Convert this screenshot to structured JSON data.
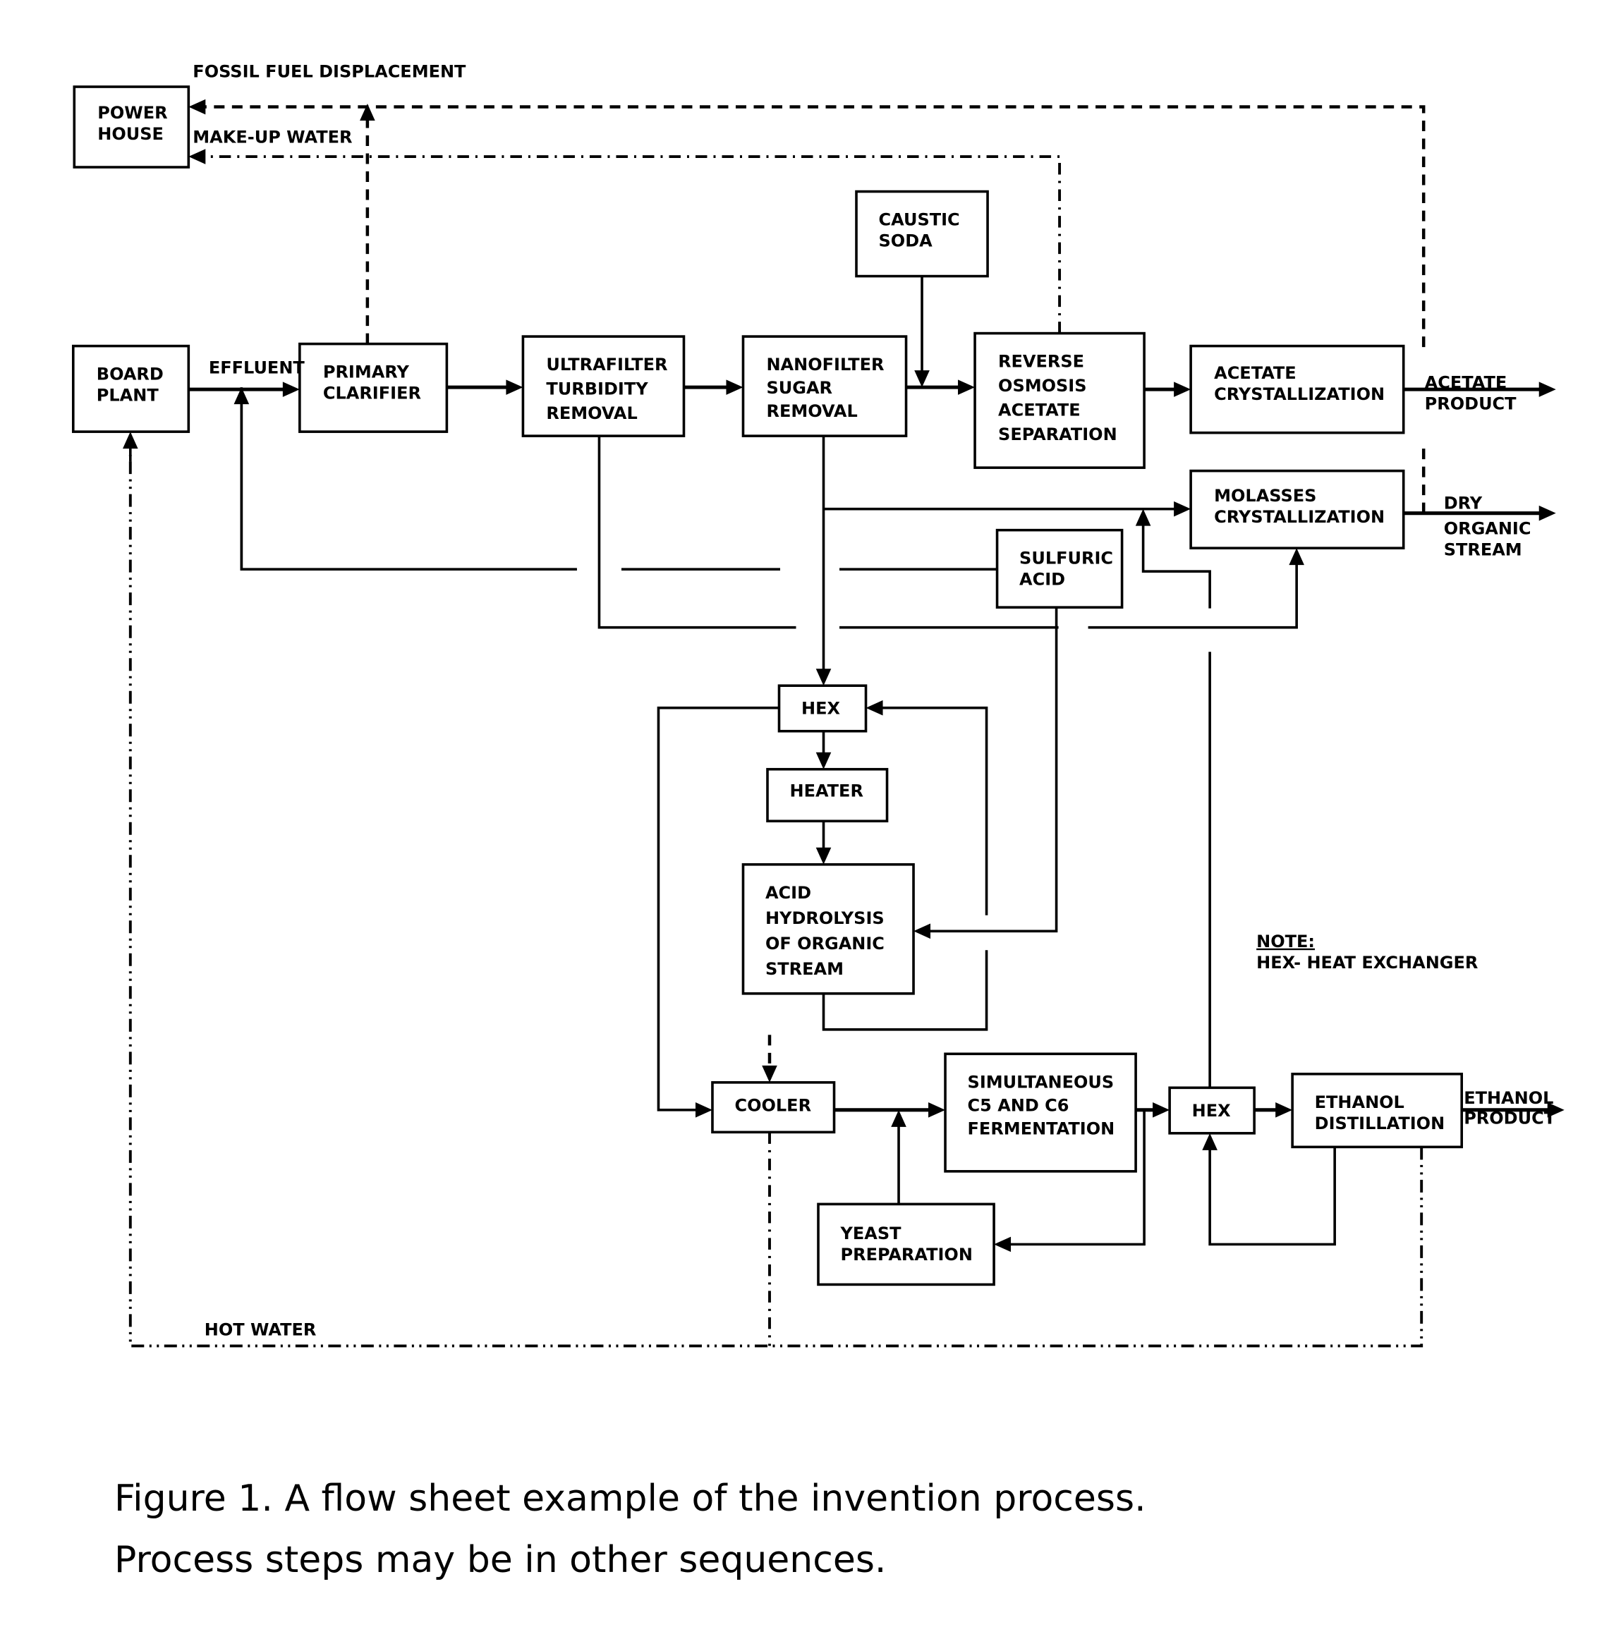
{
  "units": {
    "power_house": [
      "POWER",
      "HOUSE"
    ],
    "board_plant": [
      "BOARD",
      "PLANT"
    ],
    "primary_clarifier": [
      "PRIMARY",
      "CLARIFIER"
    ],
    "ultrafilter": [
      "ULTRAFILTER",
      "TURBIDITY",
      "REMOVAL"
    ],
    "nanofilter": [
      "NANOFILTER",
      "SUGAR",
      "REMOVAL"
    ],
    "caustic_soda": [
      "CAUSTIC",
      "SODA"
    ],
    "reverse_osmosis": [
      "REVERSE",
      "OSMOSIS",
      "ACETATE",
      "SEPARATION"
    ],
    "acetate_crystallization": [
      "ACETATE",
      "CRYSTALLIZATION"
    ],
    "molasses_crystallization": [
      "MOLASSES",
      "CRYSTALLIZATION"
    ],
    "sulfuric_acid": [
      "SULFURIC",
      "ACID"
    ],
    "hex_top": [
      "HEX"
    ],
    "heater": [
      "HEATER"
    ],
    "acid_hydrolysis": [
      "ACID",
      "HYDROLYSIS",
      "OF ORGANIC",
      "STREAM"
    ],
    "cooler": [
      "COOLER"
    ],
    "fermentation": [
      "SIMULTANEOUS",
      "C5 AND C6",
      "FERMENTATION"
    ],
    "yeast_preparation": [
      "YEAST",
      "PREPARATION"
    ],
    "hex_bottom": [
      "HEX"
    ],
    "ethanol_distillation": [
      "ETHANOL",
      "DISTILLATION"
    ]
  },
  "stream_labels": {
    "fossil_fuel": "FOSSIL FUEL DISPLACEMENT",
    "makeup_water": "MAKE-UP WATER",
    "effluent": "EFFLUENT",
    "acetate_product": [
      "ACETATE",
      "PRODUCT"
    ],
    "dry_organic": [
      "DRY",
      "ORGANIC",
      "STREAM"
    ],
    "ethanol_product": [
      "ETHANOL",
      "PRODUCT"
    ],
    "hot_water": "HOT WATER"
  },
  "note": {
    "heading": "NOTE:",
    "text": "HEX- HEAT EXCHANGER"
  },
  "caption": {
    "line1": "Figure 1. A flow sheet example of the invention process.",
    "line2": "Process steps may be in other sequences."
  }
}
